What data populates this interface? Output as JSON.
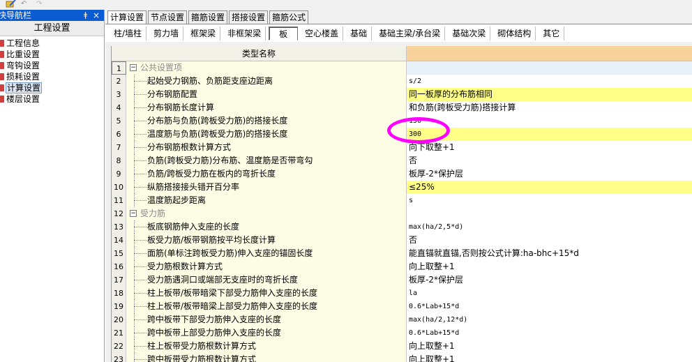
{
  "nav": {
    "title": "快导航栏",
    "pin": "ǂ",
    "close": "×",
    "header": "工程设置",
    "items": [
      {
        "label": "工程信息"
      },
      {
        "label": "比重设置"
      },
      {
        "label": "弯钩设置"
      },
      {
        "label": "损耗设置"
      },
      {
        "label": "计算设置",
        "selected": true
      },
      {
        "label": "楼层设置"
      }
    ]
  },
  "tabs": [
    "计算设置",
    "节点设置",
    "箍筋设置",
    "搭接设置",
    "箍筋公式"
  ],
  "subtabs": [
    "柱/墙柱",
    "剪力墙",
    "框架梁",
    "非框架梁",
    "板",
    "空心楼盖",
    "基础",
    "基础主梁/承台梁",
    "基础次梁",
    "砌体结构",
    "其它"
  ],
  "grid": {
    "header_name": "类型名称",
    "rows": [
      {
        "n": "1",
        "name": "公共设置项",
        "value": "",
        "group": true
      },
      {
        "n": "2",
        "name": "起始受力钢筋、负筋距支座边距离",
        "value": "s/2",
        "mono": true
      },
      {
        "n": "3",
        "name": "分布钢筋配置",
        "value": "同一板厚的分布筋相同",
        "hl": true
      },
      {
        "n": "4",
        "name": "分布钢筋长度计算",
        "value": "和负筋(跨板受力筋)搭接计算"
      },
      {
        "n": "5",
        "name": "分布筋与负筋(跨板受力筋)的搭接长度",
        "value": "150",
        "mono": true
      },
      {
        "n": "6",
        "name": "温度筋与负筋(跨板受力筋)的搭接长度",
        "value": "300",
        "mono": true,
        "hl": true
      },
      {
        "n": "7",
        "name": "分布钢筋根数计算方式",
        "value": "向下取整+1"
      },
      {
        "n": "8",
        "name": "负筋(跨板受力筋)分布筋、温度筋是否带弯勾",
        "value": "否"
      },
      {
        "n": "9",
        "name": "负筋/跨板受力筋在板内的弯折长度",
        "value": "板厚-2*保护层"
      },
      {
        "n": "10",
        "name": "纵筋搭接接头错开百分率",
        "value": "≤25%",
        "hl": true
      },
      {
        "n": "11",
        "name": "温度筋起步距离",
        "value": "s",
        "mono": true
      },
      {
        "n": "12",
        "name": "受力筋",
        "value": "",
        "group": true
      },
      {
        "n": "13",
        "name": "板底钢筋伸入支座的长度",
        "value": "max(ha/2,5*d)",
        "mono": true
      },
      {
        "n": "14",
        "name": "板受力筋/板带钢筋按平均长度计算",
        "value": "否"
      },
      {
        "n": "15",
        "name": "面筋(单标注跨板受力筋)伸入支座的锚固长度",
        "value": "能直锚就直锚,否则按公式计算:ha-bhc+15*d"
      },
      {
        "n": "16",
        "name": "受力筋根数计算方式",
        "value": "向上取整+1"
      },
      {
        "n": "17",
        "name": "受力筋遇洞口或端部无支座时的弯折长度",
        "value": "板厚-2*保护层"
      },
      {
        "n": "18",
        "name": "柱上板带/板带暗梁下部受力筋伸入支座的长度",
        "value": "la",
        "mono": true
      },
      {
        "n": "19",
        "name": "柱上板带/板带暗梁上部受力筋伸入支座的长度",
        "value": "0.6*Lab+15*d",
        "mono": true
      },
      {
        "n": "20",
        "name": "跨中板带下部受力筋伸入支座的长度",
        "value": "max(ha/2,12*d)",
        "mono": true
      },
      {
        "n": "21",
        "name": "跨中板带上部受力筋伸入支座的长度",
        "value": "0.6*Lab+15*d",
        "mono": true
      },
      {
        "n": "22",
        "name": "柱上板带受力筋根数计算方式",
        "value": "向上取整+1"
      },
      {
        "n": "23",
        "name": "跨中板带受力筋根数计算方式",
        "value": "向上取整+1"
      }
    ]
  },
  "colors": {
    "accent": "#0b5bd3",
    "highlight": "#ffff88",
    "annotation": "#ff00ff"
  }
}
